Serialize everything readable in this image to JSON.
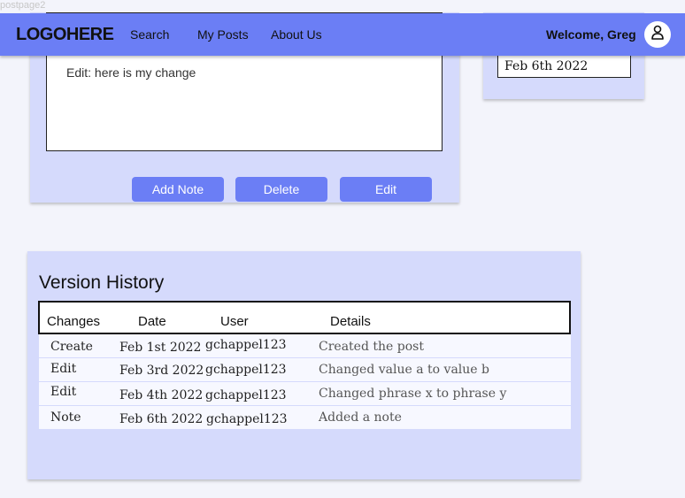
{
  "page_label": "postpage2",
  "nav": {
    "logo": "LOGOHERE",
    "items": [
      "Search",
      "My Posts",
      "About Us"
    ],
    "welcome": "Welcome, Greg"
  },
  "post": {
    "body_text": "Edit: here is my change",
    "buttons": {
      "add_note": "Add Note",
      "delete": "Delete",
      "edit": "Edit"
    }
  },
  "side": {
    "date": "Feb 6th 2022"
  },
  "history": {
    "title": "Version History",
    "columns": [
      "Changes",
      "Date",
      "User",
      "Details"
    ],
    "rows": [
      {
        "change": "Create",
        "date": "Feb 1st 2022",
        "user": "gchappel123",
        "details": "Created the post"
      },
      {
        "change": "Edit",
        "date": "Feb 3rd 2022",
        "user": "gchappel123",
        "details": "Changed value a to value b"
      },
      {
        "change": "Edit",
        "date": "Feb 4th 2022",
        "user": "gchappel123",
        "details": "Changed phrase x to phrase y"
      },
      {
        "change": "Note",
        "date": "Feb 6th 2022",
        "user": "gchappel123",
        "details": "Added a note"
      }
    ]
  },
  "colors": {
    "accent": "#6b7ef5",
    "panel": "#d5dafc",
    "page": "#f3f4fb"
  }
}
